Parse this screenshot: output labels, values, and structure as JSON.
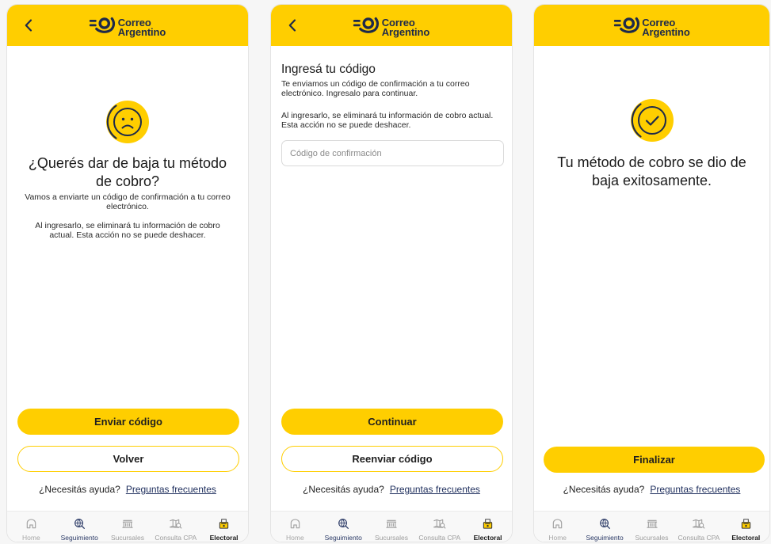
{
  "colors": {
    "accent": "#FFCE00",
    "brand_navy": "#1E2A4A",
    "text": "#1F1F1F",
    "link": "#1D2D5C"
  },
  "brand": {
    "line1": "Correo",
    "line2": "Argentino",
    "logo_icon": "correo-argentino-logo-icon"
  },
  "screens": {
    "confirm": {
      "back_icon": "chevron-left-icon",
      "status_icon": "sad-face-icon",
      "title": "¿Querés dar de baja tu método de cobro?",
      "body": [
        "Vamos a enviarte un código de confirmación a tu correo electrónico.",
        "Al ingresarlo, se eliminará tu información de cobro actual. Esta acción no se puede deshacer."
      ],
      "primary_button": "Enviar código",
      "secondary_button": "Volver"
    },
    "code": {
      "back_icon": "chevron-left-icon",
      "title": "Ingresá tu código",
      "body": [
        "Te enviamos un código de confirmación a tu correo electrónico. Ingresalo para continuar.",
        "Al ingresarlo, se eliminará tu información de cobro actual. Esta acción no se puede deshacer."
      ],
      "input": {
        "placeholder": "Código de confirmación"
      },
      "primary_button": "Continuar",
      "secondary_button": "Reenviar código"
    },
    "success": {
      "status_icon": "check-circle-icon",
      "title": "Tu método de cobro se dio de baja exitosamente.",
      "primary_button": "Finalizar"
    }
  },
  "help": {
    "question": "¿Necesitás ayuda?",
    "link": "Preguntas frecuentes"
  },
  "nav": {
    "items": [
      {
        "label": "Home",
        "icon": "home-icon",
        "color": "#A6A6A6",
        "active": false
      },
      {
        "label": "Seguimiento",
        "icon": "tracking-icon",
        "color": "#2B3A66",
        "active": false
      },
      {
        "label": "Sucursales",
        "icon": "building-icon",
        "color": "#9C9C9C",
        "active": false
      },
      {
        "label": "Consulta CPA",
        "icon": "map-icon",
        "color": "#9C9C9C",
        "active": false
      },
      {
        "label": "Electoral",
        "icon": "ballot-box-icon",
        "color": "#1A1A1A",
        "active": true
      }
    ]
  }
}
